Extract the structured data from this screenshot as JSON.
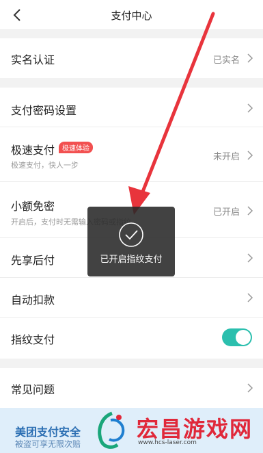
{
  "header": {
    "title": "支付中心"
  },
  "rows": {
    "realname": {
      "label": "实名认证",
      "value": "已实名"
    },
    "paypwd": {
      "label": "支付密码设置"
    },
    "fastpay": {
      "label": "极速支付",
      "badge": "极速体验",
      "sub": "极速支付，快人一步",
      "value": "未开启"
    },
    "smallfree": {
      "label": "小额免密",
      "sub": "开启后，支付时无需输入密码或指纹",
      "value": "已开启"
    },
    "paylater": {
      "label": "先享后付"
    },
    "autodebit": {
      "label": "自动扣款"
    },
    "fingerprint": {
      "label": "指纹支付",
      "enabled": true
    },
    "faq": {
      "label": "常见问题"
    }
  },
  "toast": {
    "text": "已开启指纹支付",
    "icon": "check-circle-icon"
  },
  "banner": {
    "title": "美团支付安全",
    "sub": "被盗可享无限次赔"
  },
  "watermark": {
    "brand": "宏昌游戏网",
    "url": "www.hcs-laser.com"
  },
  "colors": {
    "toggle_on": "#2bbfae",
    "badge": "#f25050",
    "arrow": "#e8343c",
    "brand": "#e0283a"
  }
}
